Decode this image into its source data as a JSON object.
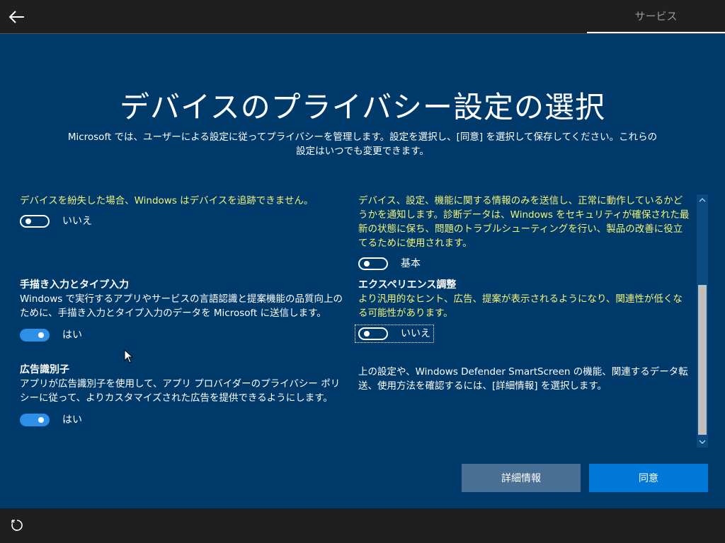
{
  "topbar": {
    "back_icon": "back-arrow-icon",
    "tab_label": "サービス"
  },
  "title": "デバイスのプライバシー設定の選択",
  "subtitle_line1": "Microsoft では、ユーザーによる設定に従ってプライバシーを管理します。設定を選択し、[同意] を選択して保存してください。これらの",
  "subtitle_line2": "設定はいつでも変更できます。",
  "left": {
    "find_device": {
      "desc": "デバイスを紛失した場合、Windows はデバイスを追跡できません。",
      "toggle_label": "いいえ",
      "on": false
    },
    "inking": {
      "heading": "手描き入力とタイプ入力",
      "desc": "Windows で実行するアプリやサービスの言語認識と提案機能の品質向上のために、手描き入力とタイプ入力のデータを Microsoft に送信します。",
      "toggle_label": "はい",
      "on": true
    },
    "advertising": {
      "heading": "広告識別子",
      "desc": "アプリが広告識別子を使用して、アプリ プロバイダーのプライバシー ポリシーに従って、よりカスタマイズされた広告を提供できるようにします。",
      "toggle_label": "はい",
      "on": true
    }
  },
  "right": {
    "diagnostics": {
      "desc": "デバイス、設定、機能に関する情報のみを送信し、正常に動作しているかどうかを通知します。診断データは、Windows をセキュリティが確保された最新の状態に保ち、問題のトラブルシューティングを行い、製品の改善に役立てるために使用されます。",
      "toggle_label": "基本",
      "on": false
    },
    "experience": {
      "heading": "エクスペリエンス調整",
      "desc": "より汎用的なヒント、広告、提案が表示されるようになり、関連性が低くなる可能性があります。",
      "toggle_label": "いいえ",
      "on": false
    },
    "note": "上の設定や、Windows Defender SmartScreen の機能、関連するデータ転送、使用方法を確認するには、[詳細情報] を選択します。"
  },
  "buttons": {
    "details": "詳細情報",
    "agree": "同意"
  },
  "colors": {
    "background": "#003a6b",
    "accent": "#0078d7",
    "highlight_text": "#f3f37a"
  }
}
